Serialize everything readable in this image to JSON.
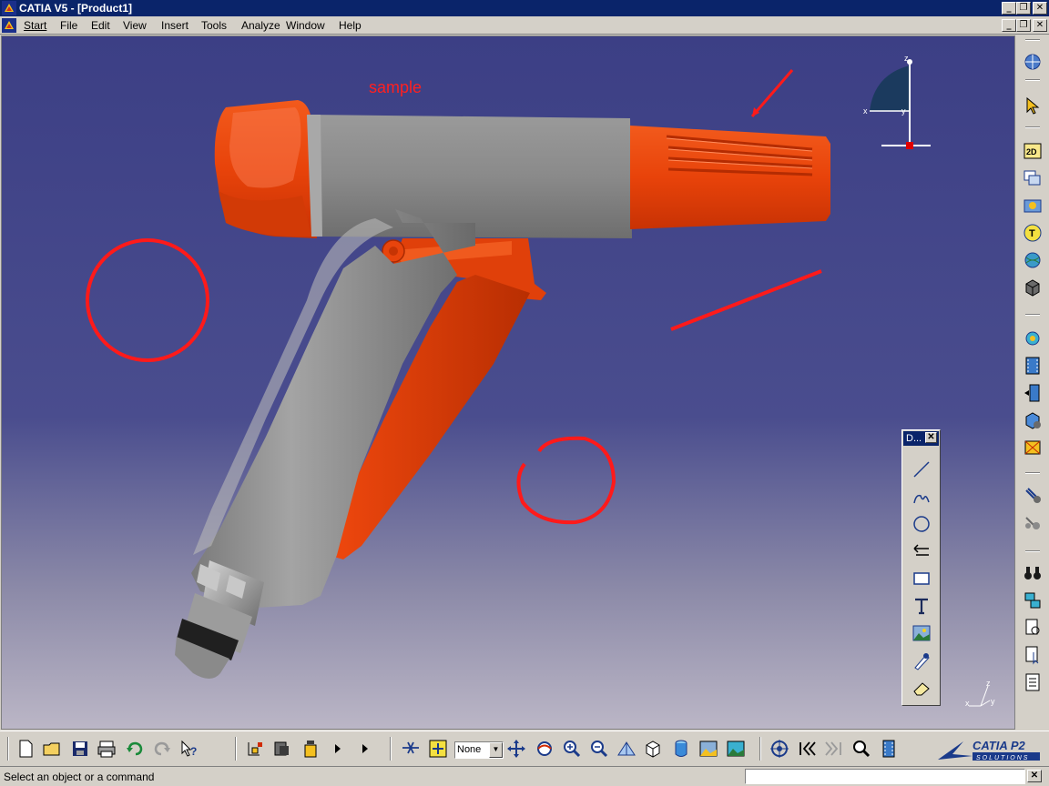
{
  "window": {
    "title": "CATIA V5 - [Product1]",
    "minimize": "_",
    "restore": "❐",
    "close": "✕"
  },
  "menubar": {
    "items": [
      {
        "label": "Start"
      },
      {
        "label": "File"
      },
      {
        "label": "Edit"
      },
      {
        "label": "View"
      },
      {
        "label": "Insert"
      },
      {
        "label": "Tools"
      },
      {
        "label": "Analyze"
      },
      {
        "label": "Window"
      },
      {
        "label": "Help"
      }
    ]
  },
  "viewport": {
    "annotation_text": "sample",
    "compass_labels": {
      "z": "z",
      "x": "x",
      "y": "y"
    },
    "axis_labels": {
      "z": "z",
      "x": "x",
      "y": "y"
    }
  },
  "drawing_toolbar": {
    "title": "D...",
    "close": "✕",
    "tools": [
      "line-icon",
      "freehand-icon",
      "circle-icon",
      "arrow-icon",
      "rectangle-icon",
      "text-icon",
      "image-icon",
      "pen-icon",
      "eraser-icon"
    ]
  },
  "right_toolbar": {
    "icons": [
      "compass-icon",
      "select-arrow-icon",
      "2d-icon",
      "windows-icon",
      "capture-icon",
      "text-t-icon",
      "globe-icon",
      "cube-icon",
      "gear-sphere-icon",
      "film-icon",
      "film-sequence-icon",
      "cube-color-icon",
      "explode-icon",
      "bolt-icon",
      "bolt-small-icon",
      "binoculars-icon",
      "assembly-icon",
      "doc-search-icon",
      "doc-pointer-icon",
      "doc-list-icon"
    ],
    "labels": {
      "2d": "2D",
      "t": "T"
    }
  },
  "bottom_toolbar": {
    "render_mode": "None",
    "logo_text": "CATIA P2",
    "logo_subtext": "SOLUTIONS"
  },
  "statusbar": {
    "message": "Select an object or a command",
    "close": "✕"
  },
  "colors": {
    "title_bar": "#0a246a",
    "viewport_top": "#3c3f85",
    "part_orange": "#f04a0e",
    "part_gray": "#8e8e8e",
    "annotation_red": "#ff2020"
  }
}
